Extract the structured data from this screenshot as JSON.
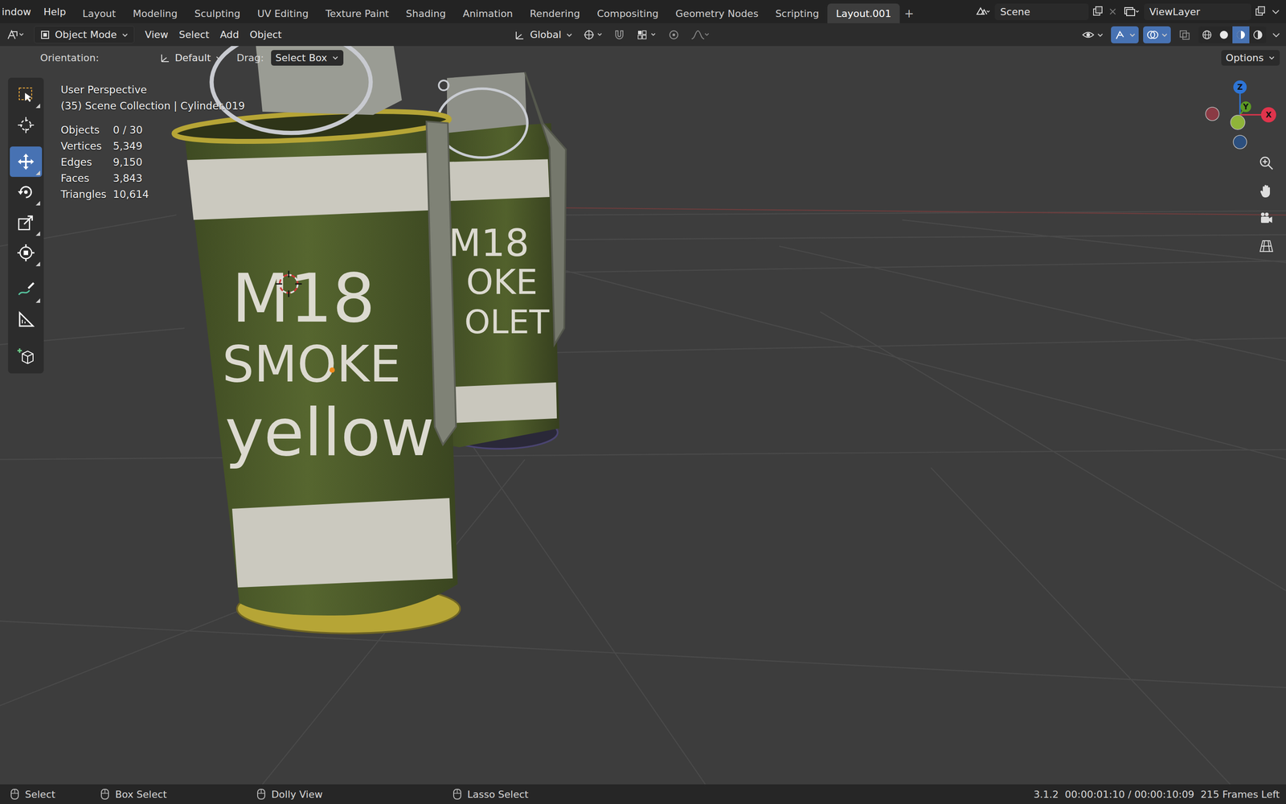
{
  "topbar": {
    "menus": [
      "indow",
      "Help"
    ],
    "workspaces": [
      {
        "label": "Layout",
        "selected": false
      },
      {
        "label": "Modeling",
        "selected": false
      },
      {
        "label": "Sculpting",
        "selected": false
      },
      {
        "label": "UV Editing",
        "selected": false
      },
      {
        "label": "Texture Paint",
        "selected": false
      },
      {
        "label": "Shading",
        "selected": false
      },
      {
        "label": "Animation",
        "selected": false
      },
      {
        "label": "Rendering",
        "selected": false
      },
      {
        "label": "Compositing",
        "selected": false
      },
      {
        "label": "Geometry Nodes",
        "selected": false
      },
      {
        "label": "Scripting",
        "selected": false
      },
      {
        "label": "Layout.001",
        "selected": true
      }
    ],
    "add_workspace": "+",
    "scene": "Scene",
    "view_layer": "ViewLayer"
  },
  "header": {
    "mode": "Object Mode",
    "menus": [
      "View",
      "Select",
      "Add",
      "Object"
    ],
    "orientation": "Global",
    "toggles": [
      {
        "kind": "visibility",
        "on": false
      },
      {
        "kind": "gizmo",
        "on": true
      },
      {
        "kind": "overlay",
        "on": true
      },
      {
        "kind": "xray",
        "on": false
      }
    ],
    "shading": [
      {
        "kind": "wireframe",
        "selected": false
      },
      {
        "kind": "solid",
        "selected": false
      },
      {
        "kind": "material",
        "selected": true
      },
      {
        "kind": "rendered",
        "selected": false
      }
    ]
  },
  "tool_settings": {
    "orientation_label": "Orientation:",
    "orientation": "Default",
    "drag_label": "Drag:",
    "drag": "Select Box",
    "options": "Options"
  },
  "toolbar": [
    {
      "kind": "select-box",
      "selected": false
    },
    {
      "kind": "cursor",
      "selected": false
    },
    {
      "kind": "move",
      "selected": true
    },
    {
      "kind": "rotate",
      "selected": false
    },
    {
      "kind": "scale",
      "selected": false
    },
    {
      "kind": "transform",
      "selected": false
    },
    {
      "kind": "annotate",
      "selected": false
    },
    {
      "kind": "measure",
      "selected": false
    },
    {
      "kind": "add-cube",
      "selected": false
    }
  ],
  "viewport": {
    "view": "User Perspective",
    "context": "(35) Scene Collection | Cylinder.019",
    "stats": [
      {
        "label": "Objects",
        "value": "0 / 30"
      },
      {
        "label": "Vertices",
        "value": "5,349"
      },
      {
        "label": "Edges",
        "value": "9,150"
      },
      {
        "label": "Faces",
        "value": "3,843"
      },
      {
        "label": "Triangles",
        "value": "10,614"
      }
    ]
  },
  "gizmo": [
    {
      "label": "",
      "color": "#8a3a44"
    },
    {
      "label": "",
      "color": "#2c4f7e"
    },
    {
      "label": "Z",
      "color": "#2e75d6"
    },
    {
      "label": "Y",
      "color": "#5c9a24"
    },
    {
      "label": "X",
      "color": "#e0344c"
    },
    {
      "label": "",
      "color": "#8fb43a"
    }
  ],
  "models": [
    {
      "lines": [
        "M18",
        "OKE",
        "OLET"
      ]
    },
    {
      "lines": [
        "M18",
        "SMOKE",
        "yellow"
      ]
    }
  ],
  "status": {
    "hints": [
      {
        "label": "Select"
      },
      {
        "label": "Box Select"
      },
      {
        "label": "Dolly View"
      },
      {
        "label": "Lasso Select"
      }
    ],
    "version": "3.1.2",
    "time": "00:00:01:10 / 00:00:10:09",
    "frames_left": "215 Frames Left"
  }
}
